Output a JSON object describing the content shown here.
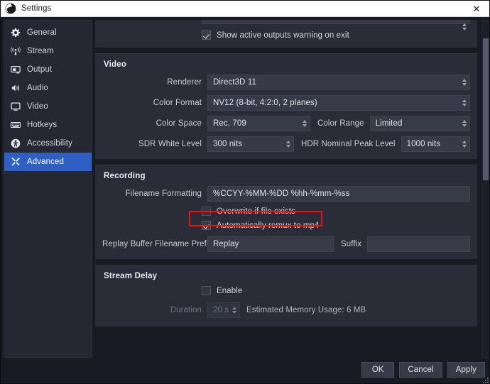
{
  "window": {
    "title": "Settings",
    "app_icon": "obs-logo-icon",
    "close_label": "✕"
  },
  "sidebar": {
    "items": [
      {
        "label": "General",
        "icon": "gear-icon",
        "selected": false
      },
      {
        "label": "Stream",
        "icon": "broadcast-icon",
        "selected": false
      },
      {
        "label": "Output",
        "icon": "output-screen-icon",
        "selected": false
      },
      {
        "label": "Audio",
        "icon": "speaker-icon",
        "selected": false
      },
      {
        "label": "Video",
        "icon": "monitor-icon",
        "selected": false
      },
      {
        "label": "Hotkeys",
        "icon": "keyboard-icon",
        "selected": false
      },
      {
        "label": "Accessibility",
        "icon": "accessibility-icon",
        "selected": false
      },
      {
        "label": "Advanced",
        "icon": "tools-icon",
        "selected": true
      }
    ]
  },
  "general_tail": {
    "show_active_outputs_warning": {
      "label": "Show active outputs warning on exit",
      "checked": true
    }
  },
  "video": {
    "title": "Video",
    "renderer": {
      "label": "Renderer",
      "value": "Direct3D 11"
    },
    "color_format": {
      "label": "Color Format",
      "value": "NV12 (8-bit, 4:2:0, 2 planes)"
    },
    "color_space": {
      "label": "Color Space",
      "value": "Rec. 709"
    },
    "color_range": {
      "label": "Color Range",
      "value": "Limited"
    },
    "sdr_white_level": {
      "label": "SDR White Level",
      "value": "300 nits"
    },
    "hdr_nominal_peak_level": {
      "label": "HDR Nominal Peak Level",
      "value": "1000 nits"
    }
  },
  "recording": {
    "title": "Recording",
    "filename_formatting": {
      "label": "Filename Formatting",
      "value": "%CCYY-%MM-%DD %hh-%mm-%ss"
    },
    "overwrite_if_file_exists": {
      "label": "Overwrite if file exists",
      "checked": false
    },
    "automatically_remux_to_mp4": {
      "label": "Automatically remux to mp4",
      "checked": true,
      "highlighted": true,
      "highlight_color": "#ee1111"
    },
    "replay_buffer_filename_prefix": {
      "label": "Replay Buffer Filename Prefix",
      "value": "Replay"
    },
    "suffix": {
      "label": "Suffix",
      "value": ""
    }
  },
  "stream_delay": {
    "title": "Stream Delay",
    "enable": {
      "label": "Enable",
      "checked": false
    },
    "duration": {
      "label": "Duration",
      "value": "20 s",
      "disabled": true
    },
    "estimated_memory_usage": "Estimated Memory Usage: 6 MB"
  },
  "footer": {
    "ok": "OK",
    "cancel": "Cancel",
    "apply": "Apply"
  },
  "theme": {
    "accent": "#2f5ec4",
    "panel_bg": "#2a2d38",
    "page_bg": "#181b22",
    "field_bg": "#373b47",
    "text": "#d2d5dc",
    "highlight": "#ee1111"
  }
}
